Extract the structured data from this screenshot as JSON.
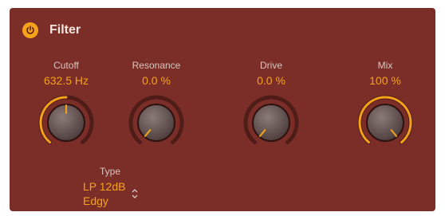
{
  "header": {
    "title": "Filter",
    "power_icon": "power-icon",
    "power_state": "on"
  },
  "accent_color": "#f5a21b",
  "panel_color": "#7b2e28",
  "params": {
    "cutoff": {
      "label": "Cutoff",
      "value": "632.5 Hz",
      "level": 0.5
    },
    "resonance": {
      "label": "Resonance",
      "value": "0.0 %",
      "level": 0.0
    },
    "drive": {
      "label": "Drive",
      "value": "0.0 %",
      "level": 0.0
    },
    "mix": {
      "label": "Mix",
      "value": "100 %",
      "level": 1.0
    }
  },
  "type": {
    "label": "Type",
    "value_line1": "LP 12dB",
    "value_line2": "Edgy",
    "stepper_icon": "up-down-chevron-icon"
  }
}
